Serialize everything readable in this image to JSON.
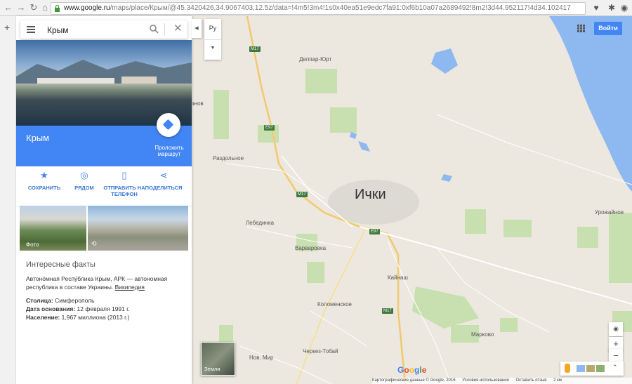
{
  "browser": {
    "url_prefix": "www.google.ru",
    "url_rest": "/maps/place/Крым/@45.3420426,34.9067403,12.5z/data=!4m5!3m4!1s0x40ea51e9edc7fa91:0xf6b10a07a2689492!8m2!3d44.952117!4d34.102417"
  },
  "search": {
    "value": "Крым"
  },
  "place": {
    "title": "Крым",
    "directions_label": "Проложить маршрут"
  },
  "actions": [
    {
      "label": "СОХРАНИТЬ",
      "icon": "star-icon"
    },
    {
      "label": "РЯДОМ",
      "icon": "nearby-icon"
    },
    {
      "label": "ОТПРАВИТЬ НА ТЕЛЕФОН",
      "icon": "phone-send-icon"
    },
    {
      "label": "ПОДЕЛИТЬСЯ",
      "icon": "share-icon"
    }
  ],
  "photos": {
    "photo_label": "Фото"
  },
  "facts": {
    "heading": "Интересные факты",
    "description": "Автоно́мная Респу́блика Крым, АРК — автономная республика в составе Украины.",
    "source_link": "Википедия",
    "capital_label": "Столица:",
    "capital_value": "Симферополь",
    "founded_label": "Дата основания:",
    "founded_value": "12 февраля 1991 г.",
    "population_label": "Население:",
    "population_value": "1,967 миллиона (2013 г.)"
  },
  "map": {
    "language_button": "Ру",
    "login_button": "Войти",
    "earth_label": "Земля",
    "main_city": "Ички",
    "places": [
      "Деппар-Юрт",
      "Раздольное",
      "Лебединка",
      "Варваровка",
      "Кайнаш",
      "Коломенское",
      "Марково",
      "Черкез-Тобай",
      "Нов. Мир",
      "Урожайное",
      "знов"
    ],
    "roads": [
      "M17",
      "E97",
      "M17",
      "E97",
      "M17"
    ]
  },
  "footer": {
    "map_data": "Картографические данные © Google, 2016",
    "terms": "Условия использования",
    "feedback": "Оставить отзыв",
    "scale": "2 км"
  },
  "colors": {
    "accent": "#4285f4",
    "green_area": "#c8dfb0",
    "water": "#8db8f0"
  }
}
